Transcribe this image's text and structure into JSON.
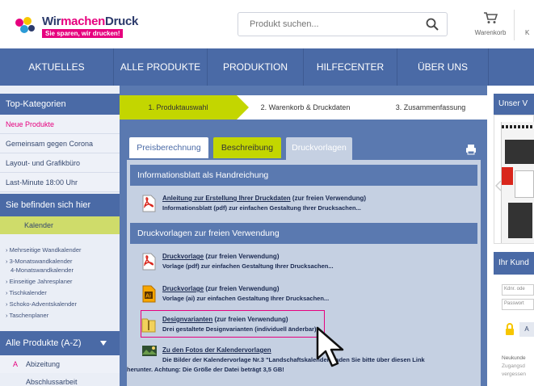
{
  "header": {
    "brand_part1": "Wir",
    "brand_part2": "machen",
    "brand_part3": "Druck",
    "tagline": "Sie sparen, wir drucken!",
    "search_placeholder": "Produkt suchen...",
    "cart_label": "Warenkorb",
    "cut_label": "K"
  },
  "nav": [
    "AKTUELLES",
    "ALLE PRODUKTE",
    "PRODUKTION",
    "HILFECENTER",
    "ÜBER UNS"
  ],
  "sidebar": {
    "top_heading": "Top-Kategorien",
    "top_items": [
      "Neue Produkte",
      "Gemeinsam gegen Corona",
      "Layout- und Grafikbüro",
      "Last-Minute 18:00 Uhr"
    ],
    "here_heading": "Sie befinden sich hier",
    "current": "Kalender",
    "sub_items": [
      "› Mehrseitige Wandkalender",
      "› 3-Monatswandkalender",
      "4-Monatswandkalender",
      "› Einseitige Jahresplaner",
      "› Tischkalender",
      "› Schoko-Adventskalender",
      "› Taschenplaner"
    ],
    "az_heading": "Alle Produkte (A-Z)",
    "az_letter": "A",
    "az_item": "Abizeitung",
    "az_item2": "Abschlussarbeit"
  },
  "steps": [
    "1. Produktauswahl",
    "2. Warenkorb & Druckdaten",
    "3. Zusammenfassung"
  ],
  "tabs": [
    "Preisberechnung",
    "Beschreibung",
    "Druckvorlagen"
  ],
  "panel": {
    "section1": "Informationsblatt als Handreichung",
    "s1_title": "Anleitung zur Erstellung Ihrer Druckdaten",
    "s1_paren": " (zur freien Verwendung)",
    "s1_desc": "Informationsblatt (pdf) zur einfachen Gestaltung Ihrer Drucksachen...",
    "section2": "Druckvorlagen zur freien Verwendung",
    "e1_title": "Druckvorlage",
    "e1_paren": " (zur freien Verwendung)",
    "e1_desc": "Vorlage (pdf) zur einfachen Gestaltung Ihrer Drucksachen...",
    "e2_title": "Druckvorlage",
    "e2_paren": " (zur freien Verwendung)",
    "e2_desc": "Vorlage (ai) zur einfachen Gestaltung Ihrer Drucksachen...",
    "e3_title": "Designvarianten",
    "e3_paren": " (zur freien Verwendung)",
    "e3_desc": "Drei gestaltete Designvarianten (individuell änderbar)",
    "e4_title": "Zu den Fotos der Kalendervorlagen",
    "e4_desc": "Die Bilder der Kalendervorlage Nr.3 \"Landschaftskalender\" laden Sie bitte über diesen Link",
    "e4_desc2": "herunter. Achtung: Die Größe der Datei beträgt 3,5 GB!"
  },
  "right": {
    "heading1": "Unser V",
    "heading2": "Ihr Kund",
    "field1": "Kdnr. ode",
    "field2": "Passwort",
    "btn": "A",
    "t1": "Neukunde",
    "t2": "Zugangsd",
    "t3": "vergessen"
  },
  "colors": {
    "nav": "#4a6aa6",
    "accent_green": "#b7cc1f",
    "magenta": "#e6007e",
    "panel": "#c5d0e2",
    "highlight_box": "#e6007e"
  }
}
